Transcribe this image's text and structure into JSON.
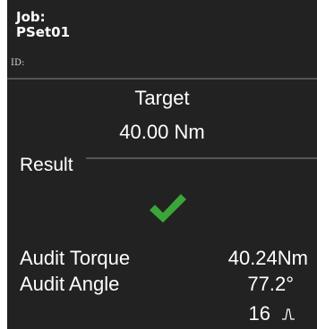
{
  "header": {
    "job_label": "Job:",
    "job_value": "PSet01",
    "id_label": "ID:"
  },
  "target": {
    "label": "Target",
    "value": "40.00 Nm"
  },
  "result": {
    "label": "Result",
    "status_icon": "check-icon",
    "status_color": "#3aa63a"
  },
  "audit": {
    "torque_label": "Audit Torque",
    "torque_value": "40.24Nm",
    "angle_label": "Audit Angle",
    "angle_value": "77.2°",
    "count_value": "16",
    "count_icon": "peak-icon"
  },
  "colors": {
    "screen_background": "#222222",
    "text": "#ffffff",
    "divider": "#555555"
  }
}
